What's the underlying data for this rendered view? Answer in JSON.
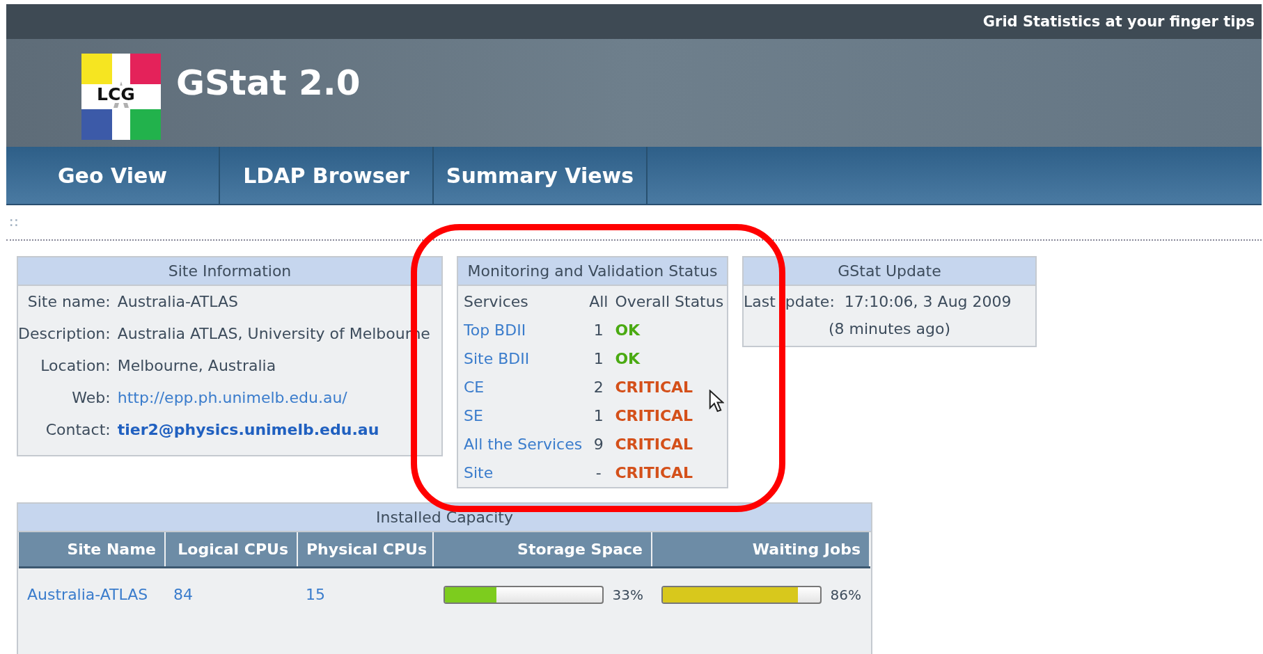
{
  "header": {
    "tagline": "Grid Statistics at your finger tips",
    "logo_text": "LCG",
    "title": "GStat 2.0"
  },
  "nav": [
    {
      "label": "Geo View"
    },
    {
      "label": "LDAP Browser"
    },
    {
      "label": "Summary Views"
    }
  ],
  "site_information": {
    "title": "Site Information",
    "fields": [
      {
        "label": "Site name:",
        "value": "Australia-ATLAS",
        "kind": "text"
      },
      {
        "label": "Description:",
        "value": "Australia ATLAS, University of Melbourne",
        "kind": "text"
      },
      {
        "label": "Location:",
        "value": "Melbourne, Australia",
        "kind": "text"
      },
      {
        "label": "Web:",
        "value": "http://epp.ph.unimelb.edu.au/",
        "kind": "link"
      },
      {
        "label": "Contact:",
        "value": "tier2@physics.unimelb.edu.au",
        "kind": "email"
      }
    ]
  },
  "monitoring": {
    "title": "Monitoring and Validation Status",
    "columns": [
      "Services",
      "All",
      "Overall Status"
    ],
    "rows": [
      {
        "service": "Top BDII",
        "count": "1",
        "status": "OK",
        "kind": "ok"
      },
      {
        "service": "Site BDII",
        "count": "1",
        "status": "OK",
        "kind": "ok"
      },
      {
        "service": "CE",
        "count": "2",
        "status": "CRITICAL",
        "kind": "critical"
      },
      {
        "service": "SE",
        "count": "1",
        "status": "CRITICAL",
        "kind": "critical"
      },
      {
        "service": "All the Services",
        "count": "9",
        "status": "CRITICAL",
        "kind": "critical"
      },
      {
        "service": "Site",
        "count": "-",
        "status": "CRITICAL",
        "kind": "critical"
      }
    ]
  },
  "update": {
    "title": "GStat Update",
    "label_parts": [
      "Last",
      "pdate:"
    ],
    "value": "17:10:06, 3 Aug 2009",
    "ago": "(8 minutes ago)"
  },
  "capacity": {
    "title": "Installed Capacity",
    "columns": [
      "Site Name",
      "Logical CPUs",
      "Physical CPUs",
      "Storage Space",
      "Waiting Jobs"
    ],
    "rows": [
      {
        "site": "Australia-ATLAS",
        "logical": "84",
        "physical": "15",
        "storage": {
          "level": 0.33,
          "reading": "33%",
          "color": "#7dcc1e"
        },
        "waiting": {
          "level": 0.86,
          "reading": "86%",
          "color": "#d8c81c"
        }
      }
    ]
  }
}
